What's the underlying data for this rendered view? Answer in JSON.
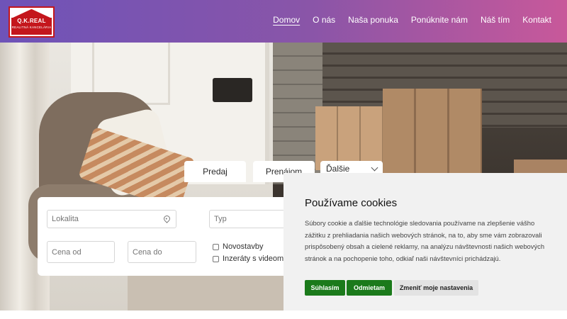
{
  "logo": {
    "name": "Q.K.REAL",
    "tagline": "REALITNÁ KANCELÁRIA"
  },
  "nav": {
    "items": [
      {
        "label": "Domov",
        "active": true
      },
      {
        "label": "O nás",
        "active": false
      },
      {
        "label": "Naša ponuka",
        "active": false
      },
      {
        "label": "Ponúknite nám",
        "active": false
      },
      {
        "label": "Náš tím",
        "active": false
      },
      {
        "label": "Kontakt",
        "active": false
      }
    ]
  },
  "search": {
    "tabs": {
      "predaj": "Predaj",
      "prenajom": "Prenájom",
      "more": "Ďalšie"
    },
    "lokalita_placeholder": "Lokalita",
    "typ_placeholder": "Typ",
    "cena_od_placeholder": "Cena od",
    "cena_do_placeholder": "Cena do",
    "checkboxes": {
      "novostavby": "Novostavby",
      "video": "Inzeráty s videom"
    }
  },
  "cookie": {
    "title": "Používame cookies",
    "text": "Súbory cookie a ďalšie technológie sledovania používame na zlepšenie vášho zážitku z prehliadania našich webových stránok, na to, aby sme vám zobrazovali prispôsobený obsah a cielené reklamy, na analýzu návštevnosti našich webových stránok a na pochopenie toho, odkiaľ naši návštevníci prichádzajú.",
    "accept": "Súhlasím",
    "reject": "Odmietam",
    "settings": "Zmeniť moje nastavenia"
  },
  "colors": {
    "accept_button": "#1b7a1b",
    "logo_red": "#c4161c",
    "header_gradient_start": "#6e53b8",
    "header_gradient_end": "#c8589a"
  },
  "icons": {
    "location": "map-pin-icon",
    "dropdown": "chevron-down-icon"
  }
}
